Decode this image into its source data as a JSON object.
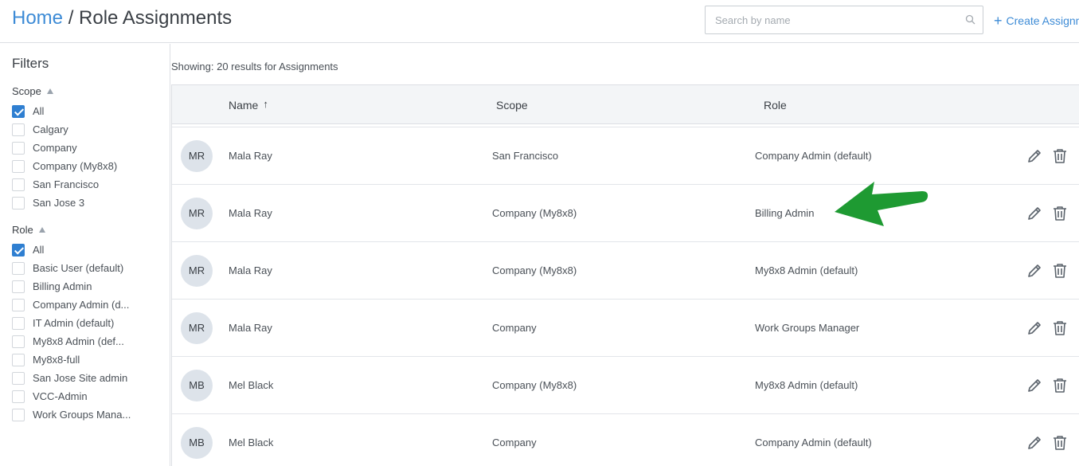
{
  "header": {
    "breadcrumb_home": "Home",
    "breadcrumb_sep": "/",
    "breadcrumb_current": "Role Assignments",
    "search_placeholder": "Search by name",
    "create_label": "Create Assignm"
  },
  "sidebar": {
    "title": "Filters",
    "scope": {
      "title": "Scope",
      "options": [
        {
          "label": "All",
          "checked": true
        },
        {
          "label": "Calgary",
          "checked": false
        },
        {
          "label": "Company",
          "checked": false
        },
        {
          "label": "Company (My8x8)",
          "checked": false
        },
        {
          "label": "San Francisco",
          "checked": false
        },
        {
          "label": "San Jose 3",
          "checked": false
        }
      ]
    },
    "role": {
      "title": "Role",
      "options": [
        {
          "label": "All",
          "checked": true
        },
        {
          "label": "Basic User (default)",
          "checked": false
        },
        {
          "label": "Billing Admin",
          "checked": false
        },
        {
          "label": "Company Admin (d...",
          "checked": false
        },
        {
          "label": "IT Admin (default)",
          "checked": false
        },
        {
          "label": "My8x8 Admin (def...",
          "checked": false
        },
        {
          "label": "My8x8-full",
          "checked": false
        },
        {
          "label": "San Jose Site admin",
          "checked": false
        },
        {
          "label": "VCC-Admin",
          "checked": false
        },
        {
          "label": "Work Groups Mana...",
          "checked": false
        }
      ]
    }
  },
  "main": {
    "showing": "Showing: 20 results for Assignments",
    "columns": {
      "name": "Name",
      "sort_arrow": "↑",
      "scope": "Scope",
      "role": "Role"
    },
    "rows": [
      {
        "initials": "MR",
        "name": "Mala Ray",
        "scope": "San Francisco",
        "role": "Company Admin (default)"
      },
      {
        "initials": "MR",
        "name": "Mala Ray",
        "scope": "Company (My8x8)",
        "role": "Billing Admin"
      },
      {
        "initials": "MR",
        "name": "Mala Ray",
        "scope": "Company (My8x8)",
        "role": "My8x8 Admin (default)"
      },
      {
        "initials": "MR",
        "name": "Mala Ray",
        "scope": "Company",
        "role": "Work Groups Manager"
      },
      {
        "initials": "MB",
        "name": "Mel Black",
        "scope": "Company (My8x8)",
        "role": "My8x8 Admin (default)"
      },
      {
        "initials": "MB",
        "name": "Mel Black",
        "scope": "Company",
        "role": "Company Admin (default)"
      }
    ]
  },
  "colors": {
    "accent": "#3d8bd6",
    "checkbox": "#2f7fd1",
    "annotation_arrow": "#1e9a32"
  },
  "icons": {
    "search": "search-icon",
    "edit": "pencil-icon",
    "delete": "trash-icon",
    "create": "plus-icon"
  }
}
